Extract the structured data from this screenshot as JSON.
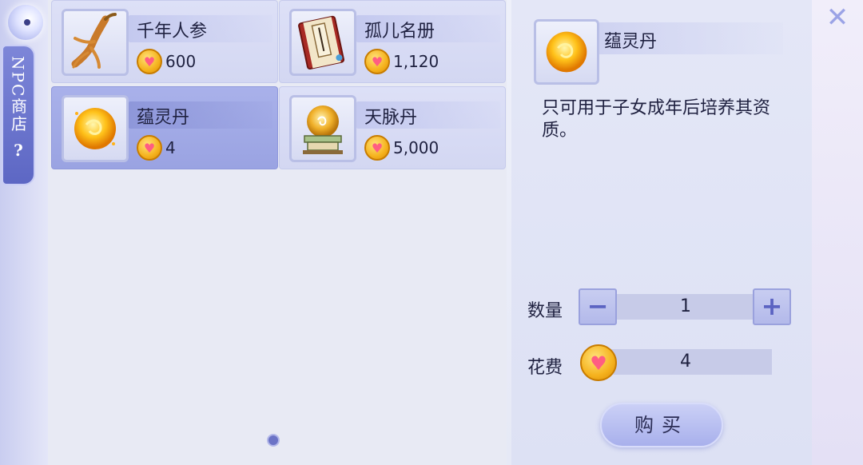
{
  "sidebar": {
    "tab_label": "NPC商店",
    "help_label": "?"
  },
  "items": [
    {
      "name": "千年人参",
      "price": "600",
      "icon": "ginseng-icon",
      "selected": false
    },
    {
      "name": "孤儿名册",
      "price": "1,120",
      "icon": "book-icon",
      "selected": false
    },
    {
      "name": "蕴灵丹",
      "price": "4",
      "icon": "golden-pill-icon",
      "selected": true
    },
    {
      "name": "天脉丹",
      "price": "5,000",
      "icon": "orb-pedestal-icon",
      "selected": false
    }
  ],
  "detail": {
    "name": "蕴灵丹",
    "description": "只可用于子女成年后培养其资质。",
    "quantity_label": "数量",
    "quantity_value": "1",
    "minus_label": "−",
    "plus_label": "+",
    "cost_label": "花费",
    "cost_value": "4",
    "buy_label": "购买"
  },
  "colors": {
    "accent": "#5d67c4",
    "selected_card": "#9aa3e2",
    "coin": "#f5b21d",
    "heart": "#ff5d82"
  }
}
